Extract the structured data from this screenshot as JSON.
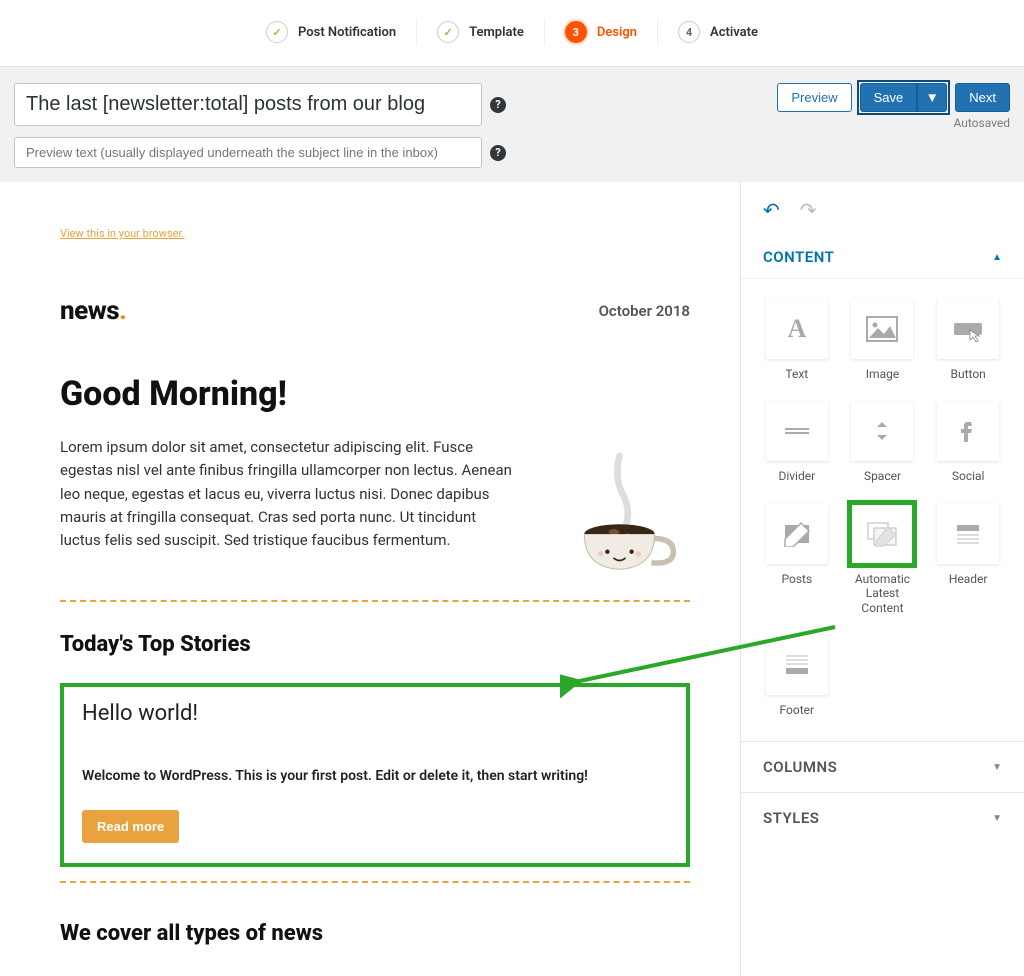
{
  "stepper": {
    "steps": [
      {
        "label": "Post Notification",
        "state": "done",
        "badge": "✓"
      },
      {
        "label": "Template",
        "state": "done",
        "badge": "✓"
      },
      {
        "label": "Design",
        "state": "active",
        "badge": "3"
      },
      {
        "label": "Activate",
        "state": "future",
        "badge": "4"
      }
    ]
  },
  "header": {
    "subject_value": "The last [newsletter:total] posts from our blog",
    "preview_placeholder": "Preview text (usually displayed underneath the subject line in the inbox)",
    "preview_btn": "Preview",
    "save_btn": "Save",
    "next_btn": "Next",
    "autosaved": "Autosaved"
  },
  "canvas": {
    "view_browser": "View this in your browser.",
    "logo_text": "news",
    "logo_dot": ".",
    "date": "October 2018",
    "greeting": "Good Morning!",
    "intro": "Lorem ipsum dolor sit amet, consectetur adipiscing elit. Fusce egestas nisl vel ante finibus fringilla ullamcorper non lectus. Aenean leo neque, egestas et lacus eu, viverra luctus nisi. Donec dapibus mauris at fringilla consequat. Cras sed porta nunc. Ut tincidunt luctus felis sed suscipit. Sed tristique faucibus fermentum.",
    "top_stories_heading": "Today's Top Stories",
    "post_title": "Hello world!",
    "post_body": "Welcome to WordPress. This is your first post. Edit or delete it, then start writing!",
    "read_more": "Read more",
    "cover_heading": "We cover all types of news"
  },
  "sidebar": {
    "content_title": "CONTENT",
    "columns_title": "COLUMNS",
    "styles_title": "STYLES",
    "widgets": {
      "text": "Text",
      "image": "Image",
      "button": "Button",
      "divider": "Divider",
      "spacer": "Spacer",
      "social": "Social",
      "posts": "Posts",
      "auto_latest": "Automatic Latest Content",
      "header": "Header",
      "footer": "Footer"
    }
  }
}
